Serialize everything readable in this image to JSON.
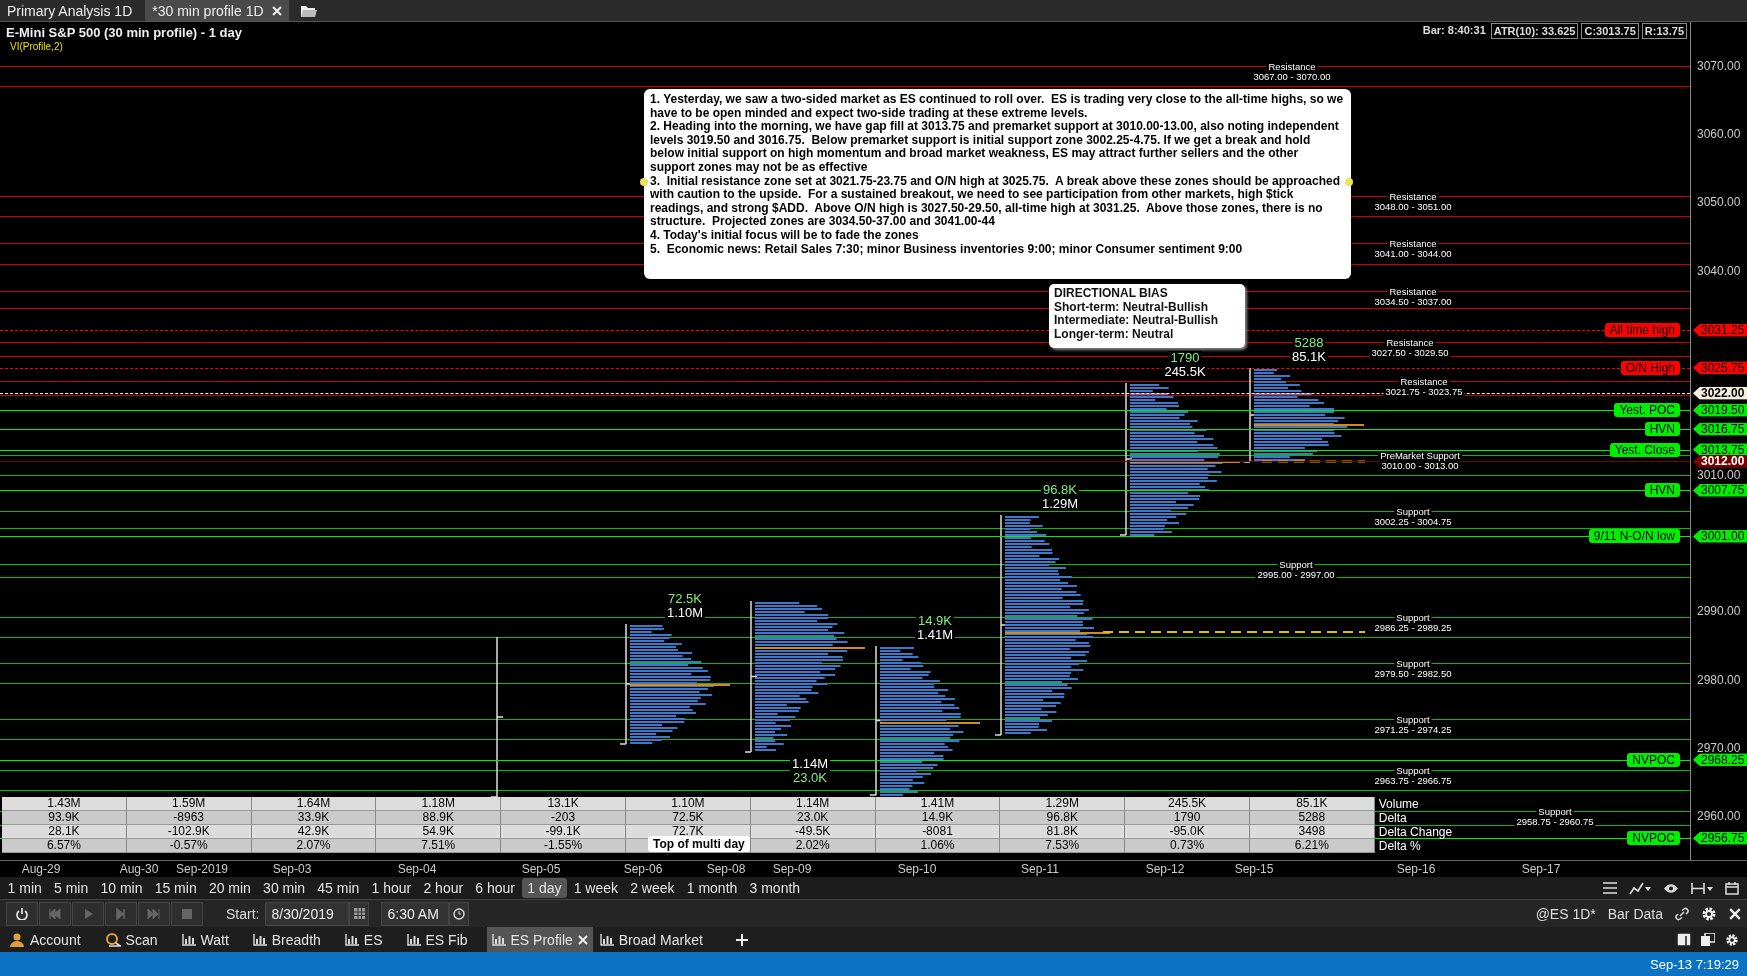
{
  "window_tabs": [
    {
      "label": "Primary Analysis 1D",
      "selected": false,
      "closable": false
    },
    {
      "label": "*30 min profile 1D",
      "selected": true,
      "closable": true
    }
  ],
  "chart": {
    "title": "E-Mini S&P 500 (30 min profile) - 1 day",
    "study": "VI(Profile,2)",
    "bar_info": "Bar: 8:40:31",
    "stats": [
      "ATR(10): 33.625",
      "C:3013.75",
      "R:13.75"
    ],
    "zones": [
      {
        "kind": "resistance",
        "label": "Resistance",
        "range": "3067.00 - 3070.00"
      },
      {
        "kind": "resistance",
        "label": "Resistance",
        "range": "3048.00 - 3051.00"
      },
      {
        "kind": "resistance",
        "label": "Resistance",
        "range": "3041.00 - 3044.00"
      },
      {
        "kind": "resistance",
        "label": "Resistance",
        "range": "3034.50 - 3037.00"
      },
      {
        "kind": "resistance",
        "label": "Resistance",
        "range": "3027.50 - 3029.50"
      },
      {
        "kind": "resistance",
        "label": "Resistance",
        "range": "3021.75 - 3023.75"
      },
      {
        "kind": "support",
        "label": "PreMarket Support",
        "range": "3010.00 - 3013.00"
      },
      {
        "kind": "support",
        "label": "Support",
        "range": "3002.25 - 3004.75"
      },
      {
        "kind": "support",
        "label": "Support",
        "range": "2995.00 - 2997.00"
      },
      {
        "kind": "support",
        "label": "Support",
        "range": "2986.25 - 2989.25"
      },
      {
        "kind": "support",
        "label": "Support",
        "range": "2979.50 - 2982.50"
      },
      {
        "kind": "support",
        "label": "Support",
        "range": "2971.25 - 2974.25"
      },
      {
        "kind": "support",
        "label": "Support",
        "range": "2963.75 - 2966.75"
      },
      {
        "kind": "support",
        "label": "Support",
        "range": "2958.75 - 2960.75"
      }
    ],
    "markers": [
      {
        "label": "All time high",
        "price": "3031.25",
        "color": "#ff0000",
        "dashed": true
      },
      {
        "label": "O/N High",
        "price": "3025.75",
        "color": "#ff0000",
        "dashed": true
      },
      {
        "price": "3022.00",
        "color": "#f4f0e0",
        "dashed": true
      },
      {
        "label": "Yest. POC",
        "price": "3019.50",
        "color": "#00ee00",
        "dashed": false
      },
      {
        "label": "HVN",
        "price": "3016.75",
        "color": "#00ee00",
        "dashed": false
      },
      {
        "label": "Yest. Close",
        "price": "3013.75",
        "color": "#00ee00",
        "dashed": false
      },
      {
        "price": "3012.00",
        "color": "#7a0000",
        "dashed": false
      },
      {
        "label": "HVN",
        "price": "3007.75",
        "color": "#00ee00",
        "dashed": false
      },
      {
        "label": "9/11 N-O/N low",
        "price": "3001.00",
        "color": "#00ee00",
        "dashed": false
      },
      {
        "label": "NVPOC",
        "price": "2968.25",
        "color": "#00ee00",
        "dashed": false
      },
      {
        "label": "NVPOC",
        "price": "2956.75",
        "color": "#00ee00",
        "dashed": false
      }
    ],
    "price_axis": [
      "3070.00",
      "3060.00",
      "3050.00",
      "3040.00",
      "3010.00",
      "2990.00",
      "2980.00",
      "2970.00",
      "2960.00"
    ],
    "profiles": [
      {
        "kind": "bare"
      },
      {
        "kind": "above",
        "delta": "72.5K",
        "volume": "1.10M"
      },
      {
        "kind": "below",
        "delta": "23.0K",
        "volume": "1.14M"
      },
      {
        "kind": "above",
        "delta": "14.9K",
        "volume": "1.41M"
      },
      {
        "kind": "above",
        "delta": "96.8K",
        "volume": "1.29M"
      },
      {
        "kind": "above",
        "delta": "1790",
        "volume": "245.5K"
      },
      {
        "kind": "above",
        "delta": "5288",
        "volume": "85.1K"
      }
    ],
    "note": {
      "paragraphs": [
        "1. Yesterday, we saw a two-sided market as ES continued to roll over.  ES is trading very close to the all-time highs, so we have to be open minded and expect two-side trading at these extreme levels.",
        "2. Heading into the morning, we have gap fill at 3013.75 and premarket support at 3010.00-13.00, also noting independent levels 3019.50 and 3016.75.  Below premarket support is initial support zone 3002.25-4.75. If we get a break and hold below initial support on high momentum and broad market weakness, ES may attract further sellers and the other support zones may not be as effective",
        "3.  Initial resistance zone set at 3021.75-23.75 and O/N high at 3025.75.  A break above these zones should be approached with caution to the upside.  For a sustained breakout, we need to see participation from other markets, high $tick readings, and strong $ADD.  Above O/N high is 3027.50-29.50, all-time high at 3031.25.  Above those zones, there is no structure.  Projected zones are 3034.50-37.00 and 3041.00-44",
        "4. Today's initial focus will be to fade the zones",
        "5.  Economic news: Retail Sales 7:30; minor Business inventories 9:00; minor Consumer sentiment 9:00"
      ]
    },
    "bias": {
      "title": "DIRECTIONAL BIAS",
      "lines": [
        "Short-term: Neutral-Bullish",
        "Intermediate: Neutral-Bullish",
        "Longer-term: Neutral"
      ]
    },
    "tooltip": "Top of multi day",
    "table": {
      "rows": [
        {
          "label": "Volume",
          "cells": [
            "1.43M",
            "1.59M",
            "1.64M",
            "1.18M",
            "13.1K",
            "1.10M",
            "1.14M",
            "1.41M",
            "1.29M",
            "245.5K",
            "85.1K"
          ]
        },
        {
          "label": "Delta",
          "cells": [
            "93.9K",
            "-8963",
            "33.9K",
            "88.9K",
            "-203",
            "72.5K",
            "23.0K",
            "14.9K",
            "96.8K",
            "1790",
            "5288"
          ]
        },
        {
          "label": "Delta Change",
          "cells": [
            "28.1K",
            "-102.9K",
            "42.9K",
            "54.9K",
            "-99.1K",
            "72.7K",
            "-49.5K",
            "-8081",
            "81.8K",
            "-95.0K",
            "3498"
          ]
        },
        {
          "label": "Delta %",
          "cells": [
            "6.57%",
            "-0.57%",
            "2.07%",
            "7.51%",
            "-1.55%",
            null,
            "2.02%",
            "1.06%",
            "7.53%",
            "0.73%",
            "6.21%"
          ]
        }
      ]
    },
    "x_axis": [
      "Aug-29",
      "Aug-30",
      "Sep-2019",
      "Sep-03",
      "Sep-04",
      "Sep-05",
      "Sep-06",
      "Sep-08",
      "Sep-09",
      "Sep-10",
      "Sep-11",
      "Sep-12",
      "Sep-15",
      "Sep-16",
      "Sep-17"
    ]
  },
  "timeframes": [
    {
      "label": "1 min",
      "selected": false
    },
    {
      "label": "5 min",
      "selected": false
    },
    {
      "label": "10 min",
      "selected": false
    },
    {
      "label": "15 min",
      "selected": false
    },
    {
      "label": "20 min",
      "selected": false
    },
    {
      "label": "30 min",
      "selected": false
    },
    {
      "label": "45 min",
      "selected": false
    },
    {
      "label": "1 hour",
      "selected": false
    },
    {
      "label": "2 hour",
      "selected": false
    },
    {
      "label": "6 hour",
      "selected": false
    },
    {
      "label": "1 day",
      "selected": true
    },
    {
      "label": "1 week",
      "selected": false
    },
    {
      "label": "2 week",
      "selected": false
    },
    {
      "label": "1 month",
      "selected": false
    },
    {
      "label": "3 month",
      "selected": false
    }
  ],
  "playback": {
    "start_label": "Start:",
    "date": "8/30/2019",
    "time": "6:30 AM",
    "symbol": "@ES 1D*",
    "bar_data": "Bar Data"
  },
  "workspace_tabs": [
    {
      "label": "Account",
      "kind": "account",
      "selected": false,
      "closable": false
    },
    {
      "label": "Scan",
      "kind": "scan",
      "selected": false,
      "closable": false
    },
    {
      "label": "Watt",
      "kind": "chart",
      "selected": false,
      "closable": false
    },
    {
      "label": "Breadth",
      "kind": "chart",
      "selected": false,
      "closable": false
    },
    {
      "label": "ES",
      "kind": "chart",
      "selected": false,
      "closable": false
    },
    {
      "label": "ES Fib",
      "kind": "chart",
      "selected": false,
      "closable": false
    },
    {
      "label": "ES Profile",
      "kind": "chart",
      "selected": true,
      "closable": true
    },
    {
      "label": "Broad Market",
      "kind": "chart",
      "selected": false,
      "closable": false
    }
  ],
  "status_bar": {
    "time": "Sep-13 7:19:29"
  }
}
